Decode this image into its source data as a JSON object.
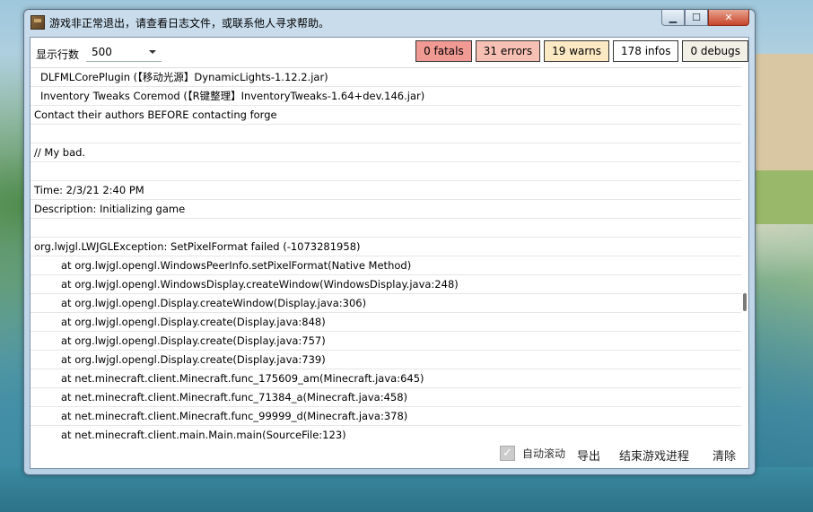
{
  "window": {
    "title": "游戏非正常退出，请查看日志文件，或联系他人寻求帮助。",
    "buttons": {
      "minimize": "▁",
      "maximize": "☐",
      "close": "✕"
    }
  },
  "toolbar": {
    "lines_label": "显示行数",
    "lines_value": "500",
    "levels": {
      "fatals": {
        "label": "0 fatals",
        "color": "#f19a94"
      },
      "errors": {
        "label": "31 errors",
        "color": "#f7c0b4"
      },
      "warns": {
        "label": "19 warns",
        "color": "#fbe9c4"
      },
      "infos": {
        "label": "178 infos",
        "color": "#ffffff"
      },
      "debugs": {
        "label": "0 debugs",
        "color": "#f2efe6"
      }
    }
  },
  "log": {
    "lines": [
      "DLFMLCorePlugin (【移动光源】DynamicLights-1.12.2.jar)",
      "Inventory Tweaks Coremod (【R键整理】InventoryTweaks-1.64+dev.146.jar)",
      "Contact their authors BEFORE contacting forge",
      "",
      "// My bad.",
      "",
      "Time: 2/3/21 2:40 PM",
      "Description: Initializing game",
      "",
      "org.lwjgl.LWJGLException: SetPixelFormat failed (-1073281958)",
      "at org.lwjgl.opengl.WindowsPeerInfo.setPixelFormat(Native Method)",
      "at org.lwjgl.opengl.WindowsDisplay.createWindow(WindowsDisplay.java:248)",
      "at org.lwjgl.opengl.Display.createWindow(Display.java:306)",
      "at org.lwjgl.opengl.Display.create(Display.java:848)",
      "at org.lwjgl.opengl.Display.create(Display.java:757)",
      "at org.lwjgl.opengl.Display.create(Display.java:739)",
      "at net.minecraft.client.Minecraft.func_175609_am(Minecraft.java:645)",
      "at net.minecraft.client.Minecraft.func_71384_a(Minecraft.java:458)",
      "at net.minecraft.client.Minecraft.func_99999_d(Minecraft.java:378)",
      "at net.minecraft.client.main.Main.main(SourceFile:123)"
    ]
  },
  "bottom": {
    "autoscroll_label": "自动滚动",
    "autoscroll_checked": true,
    "export_label": "导出",
    "kill_label": "结束游戏进程",
    "clear_label": "清除"
  }
}
